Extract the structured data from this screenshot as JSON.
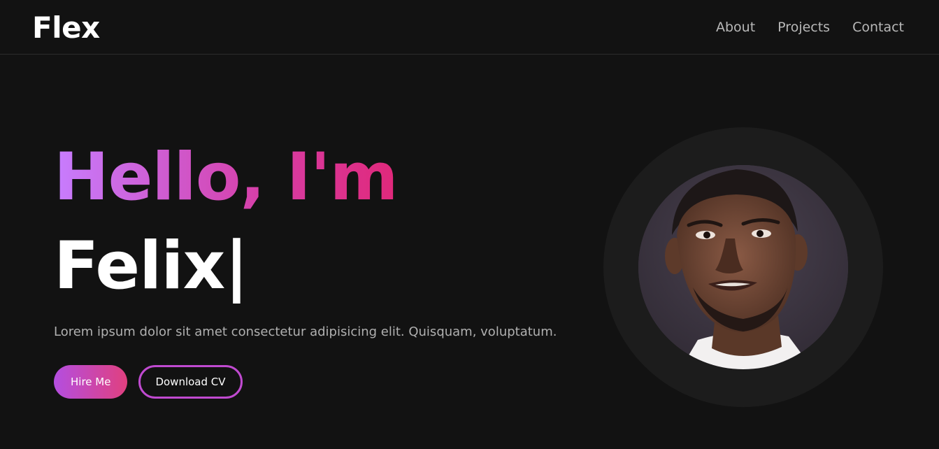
{
  "nav": {
    "brand": "Flex",
    "links": [
      "About",
      "Projects",
      "Contact"
    ]
  },
  "hero": {
    "greeting": "Hello, I'm",
    "name": "Felix",
    "cursor": "|",
    "description": "Lorem ipsum dolor sit amet consectetur adipisicing elit. Quisquam, voluptatum.",
    "primary_button": "Hire Me",
    "secondary_button": "Download CV"
  },
  "colors": {
    "background": "#121212",
    "accent_start": "#c77dff",
    "accent_end": "#e0287a"
  }
}
